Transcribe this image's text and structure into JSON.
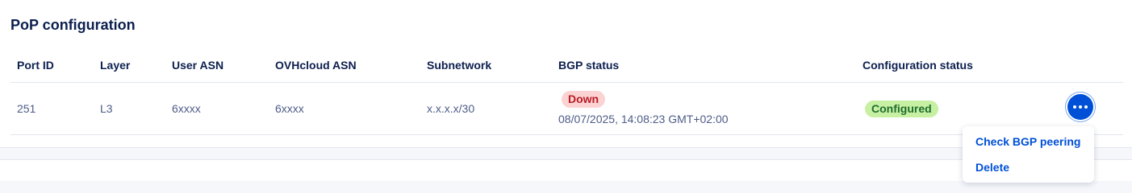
{
  "section": {
    "title": "PoP configuration"
  },
  "table": {
    "headers": {
      "port_id": "Port ID",
      "layer": "Layer",
      "user_asn": "User ASN",
      "ovhcloud_asn": "OVHcloud ASN",
      "subnetwork": "Subnetwork",
      "bgp_status": "BGP status",
      "configuration_status": "Configuration status"
    },
    "rows": [
      {
        "port_id": "251",
        "layer": "L3",
        "user_asn": "6xxxx",
        "ovhcloud_asn": "6xxxx",
        "subnetwork": "x.x.x.x/30",
        "bgp_status": "Down",
        "bgp_status_color": "#b81c25",
        "bgp_timestamp": "08/07/2025, 14:08:23 GMT+02:00",
        "configuration_status": "Configured",
        "configuration_status_color": "#1f6e2c"
      }
    ]
  },
  "actions": {
    "button_icon": "more-horizontal-icon",
    "menu": [
      {
        "label": "Check BGP peering"
      },
      {
        "label": "Delete"
      }
    ]
  },
  "colors": {
    "accent": "#0050d7",
    "heading": "#0c1f4f"
  }
}
